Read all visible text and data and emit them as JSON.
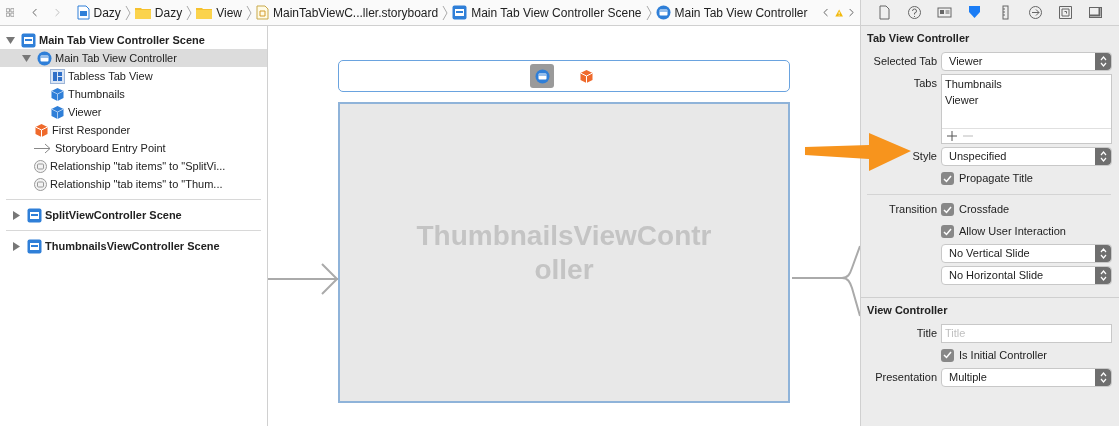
{
  "jump_bar": {
    "breadcrumbs": [
      {
        "label": "Dazy",
        "kind": "project"
      },
      {
        "label": "Dazy",
        "kind": "folder"
      },
      {
        "label": "View",
        "kind": "folder"
      },
      {
        "label": "MainTabViewC...ller.storyboard",
        "kind": "storyboard"
      },
      {
        "label": "Main Tab View Controller Scene",
        "kind": "scene"
      },
      {
        "label": "Main Tab View Controller",
        "kind": "controller"
      }
    ],
    "warning": true
  },
  "inspector_tabs": [
    {
      "kind": "file",
      "selected": false
    },
    {
      "kind": "help",
      "selected": false
    },
    {
      "kind": "identity",
      "selected": false
    },
    {
      "kind": "attributes",
      "selected": true
    },
    {
      "kind": "size",
      "selected": false
    },
    {
      "kind": "connections",
      "selected": false
    },
    {
      "kind": "bindings",
      "selected": false
    },
    {
      "kind": "effects",
      "selected": false
    }
  ],
  "outline": [
    {
      "label": "Main Tab View Controller Scene",
      "kind": "scene",
      "expanded": true,
      "selected": false,
      "children": [
        {
          "label": "Main Tab View Controller",
          "kind": "controller",
          "expanded": true,
          "selected": true,
          "children": [
            {
              "label": "Tabless Tab View",
              "kind": "tabview",
              "selected": false
            },
            {
              "label": "Thumbnails",
              "kind": "cube",
              "selected": false
            },
            {
              "label": "Viewer",
              "kind": "cube",
              "selected": false
            }
          ]
        },
        {
          "label": "First Responder",
          "kind": "responder",
          "selected": false
        },
        {
          "label": "Storyboard Entry Point",
          "kind": "entry",
          "selected": false
        },
        {
          "label": "Relationship \"tab items\" to \"SplitVi...",
          "kind": "relationship",
          "selected": false
        },
        {
          "label": "Relationship \"tab items\" to \"Thum...",
          "kind": "relationship",
          "selected": false
        }
      ]
    },
    {
      "label": "SplitViewController Scene",
      "kind": "scene",
      "expanded": false,
      "selected": false
    },
    {
      "label": "ThumbnailsViewController Scene",
      "kind": "scene",
      "expanded": false,
      "selected": false
    }
  ],
  "canvas": {
    "scene_bar": [
      {
        "kind": "controller",
        "selected": true
      },
      {
        "kind": "responder",
        "selected": false
      }
    ],
    "view_title": "ThumbnailsViewController"
  },
  "inspector": {
    "sections": [
      {
        "title": "Tab View Controller",
        "rows": [
          {
            "kind": "popup",
            "label": "Selected Tab",
            "value": "Viewer"
          },
          {
            "kind": "list",
            "label": "Tabs",
            "items": [
              "Thumbnails",
              "Viewer"
            ]
          },
          {
            "kind": "popup",
            "label": "Style",
            "value": "Unspecified"
          },
          {
            "kind": "checkbox",
            "text": "Propagate Title",
            "checked": true
          },
          {
            "kind": "divider"
          },
          {
            "kind": "checkbox",
            "label": "Transition",
            "text": "Crossfade",
            "checked": true
          },
          {
            "kind": "checkbox",
            "text": "Allow User Interaction",
            "checked": true
          },
          {
            "kind": "popup",
            "value": "No Vertical Slide"
          },
          {
            "kind": "popup",
            "value": "No Horizontal Slide"
          }
        ]
      },
      {
        "title": "View Controller",
        "rows": [
          {
            "kind": "field",
            "label": "Title",
            "placeholder": "Title"
          },
          {
            "kind": "checkbox",
            "text": "Is Initial Controller",
            "checked": true
          },
          {
            "kind": "popup",
            "label": "Presentation",
            "value": "Multiple"
          }
        ]
      }
    ]
  }
}
